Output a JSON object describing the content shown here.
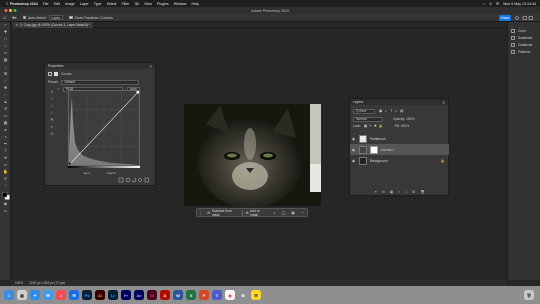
{
  "menubar": {
    "items": [
      "Photoshop 2024",
      "File",
      "Edit",
      "Image",
      "Layer",
      "Type",
      "Select",
      "Filter",
      "3D",
      "View",
      "Plugins",
      "Window",
      "Help"
    ],
    "datetime": "Mon 6 May  13:14:44"
  },
  "app_title": "Adobe Photoshop 2024",
  "options": {
    "auto_select_label": "Auto-Select:",
    "auto_select_value": "Layer",
    "show_transform": "Show Transform Controls",
    "share_label": "Share"
  },
  "doc_tab": "2. Copy.jpg @ 100% (Curves 1, Layer Mask/8) *",
  "properties": {
    "title": "Properties",
    "adjustment": "Curves",
    "preset_label": "Preset:",
    "preset_value": "Default",
    "channel_value": "RGB",
    "auto_label": "Auto",
    "input_label": "Input:",
    "output_label": "Output:"
  },
  "contextual_bar": {
    "subtract": "Subtract from mask",
    "add": "Add to mask"
  },
  "layers": {
    "title": "Layers",
    "kind_value": "Q Kind",
    "blend_mode": "Normal",
    "opacity_label": "Opacity: 100%",
    "lock_label": "Lock:",
    "fill_label": "Fill: 100%",
    "rows": [
      {
        "name": "Paintbrush"
      },
      {
        "name": "Curves 1"
      },
      {
        "name": "Background"
      }
    ]
  },
  "right_dock": {
    "items": [
      "Color",
      "Swatches",
      "Gradients",
      "Patterns"
    ]
  },
  "status": {
    "zoom": "100%",
    "doc_info": "2000 px x 834 px (72 ppi)"
  },
  "dock_apps": [
    "Finder",
    "Launchpad",
    "Safari",
    "Mail",
    "Music",
    "Xcode",
    "Photoshop",
    "Illustrator",
    "Lightroom",
    "Premiere",
    "After Effects",
    "InDesign",
    "Acrobat",
    "Word",
    "Excel",
    "PowerPoint",
    "Teams",
    "Chrome",
    "Settings",
    "Notes",
    "Trash"
  ]
}
